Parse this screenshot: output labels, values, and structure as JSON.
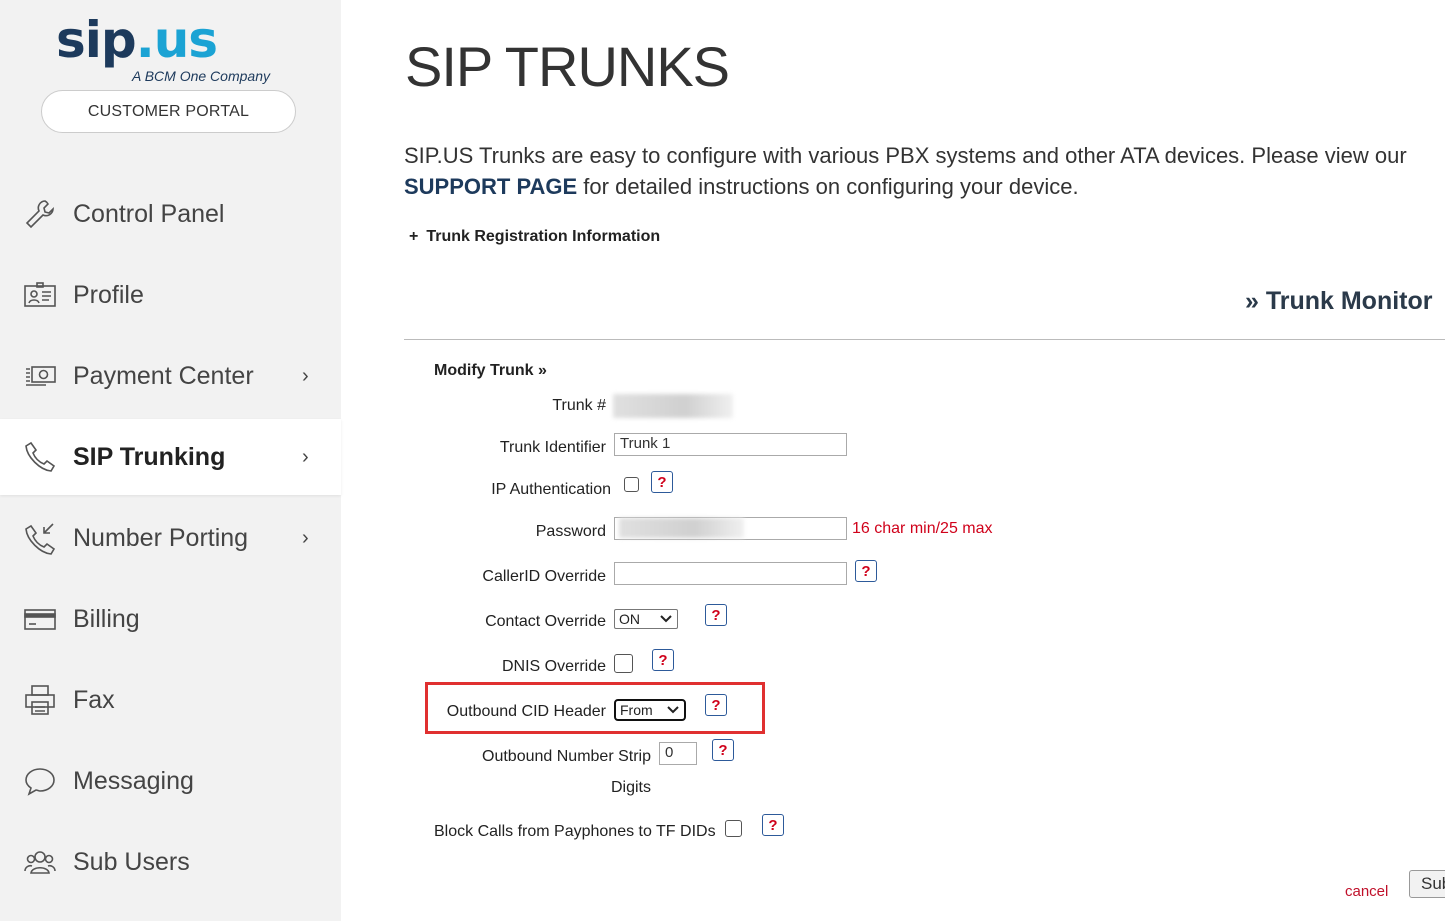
{
  "brand": {
    "logo_main": "sip",
    "logo_dot": ".",
    "logo_suffix": "us",
    "tagline": "A BCM One Company",
    "portal_button": "CUSTOMER PORTAL"
  },
  "sidebar": {
    "items": [
      {
        "label": "Control Panel",
        "icon": "wrench-icon",
        "chevron": false,
        "active": false
      },
      {
        "label": "Profile",
        "icon": "id-card-icon",
        "chevron": false,
        "active": false
      },
      {
        "label": "Payment Center",
        "icon": "money-icon",
        "chevron": true,
        "active": false
      },
      {
        "label": "SIP Trunking",
        "icon": "phone-icon",
        "chevron": true,
        "active": true
      },
      {
        "label": "Number Porting",
        "icon": "phone-incoming-icon",
        "chevron": true,
        "active": false
      },
      {
        "label": "Billing",
        "icon": "credit-card-icon",
        "chevron": false,
        "active": false
      },
      {
        "label": "Fax",
        "icon": "printer-icon",
        "chevron": false,
        "active": false
      },
      {
        "label": "Messaging",
        "icon": "chat-bubble-icon",
        "chevron": false,
        "active": false
      },
      {
        "label": "Sub Users",
        "icon": "users-icon",
        "chevron": false,
        "active": false
      }
    ],
    "chevron_glyph": "›"
  },
  "main": {
    "title": "SIP TRUNKS",
    "intro_text_1": "SIP.US Trunks are easy to configure with various PBX systems and other ATA devices. Please view our",
    "intro_link": "SUPPORT PAGE",
    "intro_text_2": " for detailed instructions on configuring your device.",
    "reg_info_toggle": "+",
    "reg_info_label": "Trunk Registration Information",
    "trunk_monitor": "» Trunk Monitor",
    "modify_heading": "Modify Trunk »"
  },
  "form": {
    "trunk_number_label": "Trunk #",
    "trunk_identifier_label": "Trunk Identifier",
    "trunk_identifier_value": "Trunk 1",
    "ip_auth_label": "IP Authentication",
    "password_label": "Password",
    "password_hint": "16 char min/25 max",
    "callerid_label": "CallerID Override",
    "contact_override_label": "Contact Override",
    "contact_override_value": "ON",
    "dnis_label": "DNIS Override",
    "outbound_cid_label": "Outbound CID Header",
    "outbound_cid_value": "From",
    "strip_label_1": "Outbound Number Strip",
    "strip_label_2": "Digits",
    "strip_value": "0",
    "payphone_label": "Block Calls from Payphones to TF DIDs",
    "help_glyph": "?",
    "cancel_label": "cancel",
    "submit_label": "Submit"
  },
  "colors": {
    "brand_navy": "#1d3a5c",
    "brand_cyan": "#1ba3d4",
    "error_red": "#d0021b",
    "highlight_red": "#e03030"
  }
}
